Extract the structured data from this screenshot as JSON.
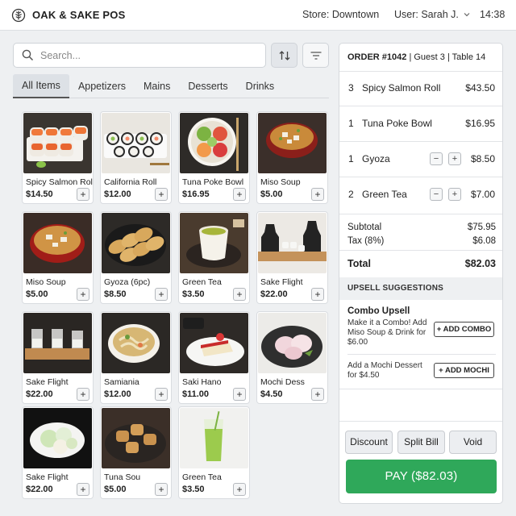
{
  "header": {
    "brand": "OAK & SAKE POS",
    "store": "Store: Downtown",
    "user": "User: Sarah J.",
    "time": "14:38"
  },
  "search": {
    "placeholder": "Search..."
  },
  "tabs": [
    {
      "label": "All Items",
      "active": true
    },
    {
      "label": "Appetizers",
      "active": false
    },
    {
      "label": "Mains",
      "active": false
    },
    {
      "label": "Desserts",
      "active": false
    },
    {
      "label": "Drinks",
      "active": false
    }
  ],
  "menu_items": [
    {
      "name": "Spicy Salmon Roll",
      "price": "$14.50",
      "image": "salmon-roll"
    },
    {
      "name": "California Roll",
      "price": "$12.00",
      "image": "california-roll"
    },
    {
      "name": "Tuna Poke Bowl",
      "price": "$16.95",
      "image": "poke-bowl"
    },
    {
      "name": "Miso Soup",
      "price": "$5.00",
      "image": "miso-soup"
    },
    {
      "name": "Miso Soup",
      "price": "$5.00",
      "image": "miso-soup"
    },
    {
      "name": "Gyoza (6pc)",
      "price": "$8.50",
      "image": "gyoza"
    },
    {
      "name": "Green Tea",
      "price": "$3.50",
      "image": "green-tea"
    },
    {
      "name": "Sake Flight",
      "price": "$22.00",
      "image": "sake-set"
    },
    {
      "name": "Sake Flight",
      "price": "$22.00",
      "image": "sake-flight"
    },
    {
      "name": "Samiania",
      "price": "$12.00",
      "image": "noodle-bowl"
    },
    {
      "name": "Saki Hano",
      "price": "$11.00",
      "image": "cheesecake"
    },
    {
      "name": "Mochi Dess",
      "price": "$4.50",
      "image": "mochi"
    },
    {
      "name": "Sake Flight",
      "price": "$22.00",
      "image": "mochi-plate"
    },
    {
      "name": "Tuna Sou",
      "price": "$5.00",
      "image": "tofu"
    },
    {
      "name": "Green Tea",
      "price": "$3.50",
      "image": "iced-tea"
    }
  ],
  "add_label": "+",
  "order": {
    "title": "ORDER #1042",
    "guest": "Guest 3",
    "table": "Table 14",
    "lines": [
      {
        "qty": "3",
        "name": "Spicy Salmon Roll",
        "price": "$43.50",
        "stepper": false
      },
      {
        "qty": "1",
        "name": "Tuna Poke Bowl",
        "price": "$16.95",
        "stepper": false
      },
      {
        "qty": "1",
        "name": "Gyoza",
        "price": "$8.50",
        "stepper": true
      },
      {
        "qty": "2",
        "name": "Green Tea",
        "price": "$7.00",
        "stepper": true
      }
    ],
    "minus": "−",
    "plus": "+",
    "subtotal_label": "Subtotal",
    "subtotal": "$75.95",
    "tax_label": "Tax (8%)",
    "tax": "$6.08",
    "total_label": "Total",
    "total": "$82.03"
  },
  "upsell": {
    "heading": "UPSELL SUGGESTIONS",
    "combo_title": "Combo Upsell",
    "combo_text": "Make it a Combo! Add Miso Soup & Drink for $6.00",
    "combo_button": "+ ADD COMBO",
    "mochi_text": "Add a Mochi Dessert for $4.50",
    "mochi_button": "+ ADD MOCHI"
  },
  "actions": {
    "discount": "Discount",
    "split": "Split Bill",
    "void": "Void",
    "pay": "PAY ($82.03)"
  },
  "colors": {
    "pay": "#2fa85a",
    "active_tab": "#dde1e6"
  }
}
